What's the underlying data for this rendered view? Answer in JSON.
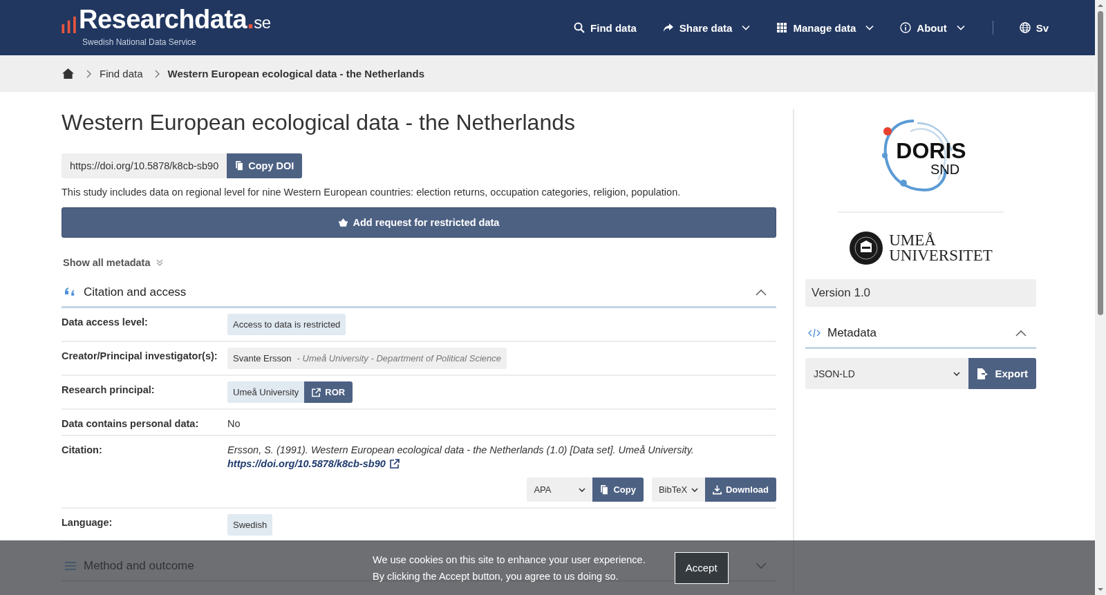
{
  "header": {
    "logo": {
      "name": "Researchdata",
      "dot": ".",
      "tld": "se",
      "tagline": "Swedish National Data Service"
    },
    "nav": [
      {
        "label": "Find data",
        "kind": "search",
        "dropdown": false
      },
      {
        "label": "Share data",
        "kind": "share",
        "dropdown": true
      },
      {
        "label": "Manage data",
        "kind": "grid",
        "dropdown": true
      },
      {
        "label": "About",
        "kind": "info",
        "dropdown": true
      }
    ],
    "language": "Sv"
  },
  "breadcrumb": [
    "Find data",
    "Western European ecological data - the Netherlands"
  ],
  "title": "Western European ecological data - the Netherlands",
  "doi": {
    "url": "https://doi.org/10.5878/k8cb-sb90",
    "button": "Copy DOI"
  },
  "description": "This study includes data on regional level for nine Western European countries: election returns, occupation categories, religion, population.",
  "request_button": "Add request for restricted data",
  "show_all_metadata": "Show all metadata",
  "sections": [
    {
      "title": "Citation and access",
      "kind": "quote",
      "expanded": true,
      "rows": [
        {
          "label": "Data access level:",
          "kind": "tag",
          "value": "Access to data is restricted"
        },
        {
          "label": "Creator/Principal investigator(s):",
          "kind": "person",
          "value": "Svante Ersson",
          "affiliation": "- Umeå University - Department of Political Science"
        },
        {
          "label": "Research principal:",
          "kind": "org",
          "value": "Umeå University",
          "button": "ROR"
        },
        {
          "label": "Data contains personal data:",
          "kind": "text",
          "value": "No"
        },
        {
          "label": "Citation:",
          "kind": "citation",
          "value": "Ersson, S. (1991). Western European ecological data - the Netherlands (1.0) [Data set]. Umeå University.",
          "link": "https://doi.org/10.5878/k8cb-sb90",
          "style": "APA",
          "copy": "Copy",
          "format": "BibTeX",
          "download": "Download"
        },
        {
          "label": "Language:",
          "kind": "tag",
          "value": "Swedish"
        }
      ]
    },
    {
      "title": "Method and outcome",
      "kind": "method",
      "expanded": false
    }
  ],
  "sidebar": {
    "doris": {
      "name": "DORIS",
      "sub": "SND"
    },
    "university": [
      "UMEÅ",
      "UNIVERSITET"
    ],
    "version": "Version 1.0",
    "metadata": {
      "title": "Metadata",
      "expanded": true,
      "format": "JSON-LD",
      "button": "Export"
    }
  },
  "cookie": {
    "lines": [
      "We use cookies on this site to enhance your user experience.",
      "By clicking the Accept button, you agree to us doing so."
    ],
    "button": "Accept"
  }
}
